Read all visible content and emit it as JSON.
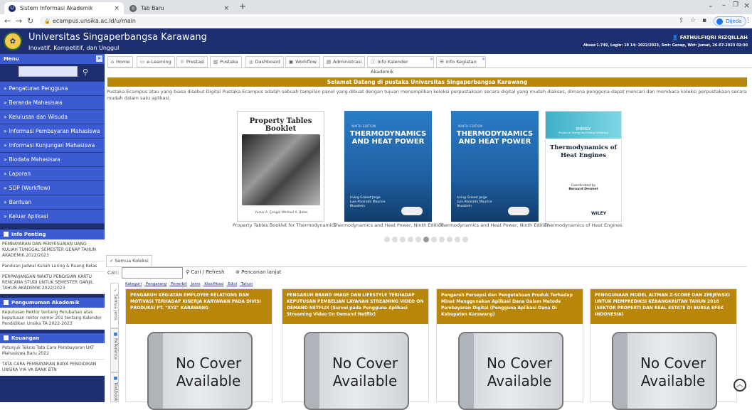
{
  "browser": {
    "tabs": [
      {
        "title": "Sistem Informasi Akademik",
        "active": true
      },
      {
        "title": "Tab Baru",
        "active": false
      }
    ],
    "new_tab": "+",
    "url": "ecampus.unsika.ac.id/u/main",
    "profile_label": "Dijeda"
  },
  "header": {
    "university": "Universitas Singaperbangsa Karawang",
    "tagline": "Inovatif, Kompetitif, dan Unggul",
    "user": "FATHULFIQRI RIZQILLAH",
    "access": "Akses:1.749, Login: 19 14: 2022/2023, Smt: Genap, Wkt: Jumat, 26-07-2023 02:30"
  },
  "sidebar": {
    "title": "Menu",
    "items": [
      "Pengaturan Pengguna",
      "Beranda Mahasiswa",
      "Kelulusan dan Wisuda",
      "Informasi Pembayaran Mahasiswa",
      "Informasi Kunjungan Mahasiswa",
      "Biodata Mahasiswa",
      "Laporan",
      "SOP (Workflow)",
      "Bantuan",
      "Keluar Aplikasi"
    ],
    "boxes": [
      {
        "title": "Info Penting",
        "items": [
          "PEMBAYARAN DAN PENYESUAIAN UANG KULIAH TUNGGAL SEMESTER GENAP TAHUN AKADEMIK 2022/2023",
          "Panduan Jadwal Kuliah Luring & Ruang Kelas",
          "PERPANJANGAN WAKTU PENGISIAN KARTU RENCANA STUDI UNTUK SEMESTER GANJIL TAHUN AKADEMIK 2022/2023"
        ]
      },
      {
        "title": "Pengumuman Akademik",
        "items": [
          "Keputusan Rektor tentang Perubahan atas keputusan rektor nomor 201 tentang Kalender Pendidikan Unsika TA 2022-2023"
        ]
      },
      {
        "title": "Keuangan",
        "items": [
          "Petunjuk Teknis Tata Cara Pembayaran UKT Mahasiswa Baru 2022",
          "TATA CARA PEMBAYARAN BIAYA PENDIDIKAN UNSIKA VIA VA BANK BTN"
        ]
      }
    ]
  },
  "tabs": [
    {
      "label": "Home",
      "icon": "home-icon"
    },
    {
      "label": "e-Learning",
      "icon": "monitor-icon"
    },
    {
      "label": "Prestasi",
      "icon": "trophy-icon"
    },
    {
      "label": "Pustaka",
      "icon": "library-icon"
    },
    {
      "label": "Dashboard",
      "icon": "dashboard-icon"
    },
    {
      "label": "Workflow",
      "icon": "workflow-icon"
    },
    {
      "label": "Administrasi",
      "icon": "admin-icon"
    },
    {
      "label": "Info Kalender Akademik",
      "icon": "info-icon"
    },
    {
      "label": "Info Kegiatan",
      "icon": "list-icon"
    }
  ],
  "main": {
    "welcome": "Selamat Datang di pustaka Universitas Singaperbangsa Karawang",
    "description": "Pustaka Ecampus atau yang biasa disebut Digital Pustaka Ecampus adalah sebuah tampilan panel yang dibuat dengan tujuan menampilkan koleksi perpustakaan secara digital yang mudah diakses, dimana pengguna dapat mencari dan membaca koleksi perpustakaan secara mudah dalam satu aplikasi.",
    "books": [
      {
        "caption": "Property Tables Booklet for Thermodynamics",
        "cover_title": "Property Tables Booklet",
        "cover_sub": "to accompany",
        "authors": "Yunus A. Çengel  Michael A. Boles"
      },
      {
        "caption": "Thermodynamics and Heat Power, Ninth Edition",
        "edition": "NINTH EDITION",
        "cover_title": "THERMODYNAMICS AND HEAT POWER",
        "authors": "Irving Granet  Jorge Luis Alvarado  Maurice Bluestein"
      },
      {
        "caption": "Thermodynamics and Heat Power, Ninth Edition",
        "edition": "NINTH EDITION",
        "cover_title": "THERMODYNAMICS AND HEAT POWER",
        "authors": "Irving Granet  Jorge Luis Alvarado  Maurice Bluestein"
      },
      {
        "caption": "Thermodynamics of Heat Engines",
        "series": "ENERGY",
        "subseries": "Physics of Energy and Energy Efficiency",
        "cover_title": "Thermodynamics of Heat Engines",
        "coordinated": "Coordinated by",
        "coordinator": "Bernard Desmet",
        "publisher": "WILEY"
      }
    ],
    "carousel_dots": 11,
    "carousel_active": 5
  },
  "collection": {
    "tab": "Semua Koleksi",
    "search_label": "Cari:",
    "search_value": "",
    "search_button": "Cari / Refresh",
    "advanced": "Pencarian lanjut",
    "filters": [
      "Kategori",
      "Pengarang",
      "Penerbit",
      "Jenis",
      "Klasifikasi",
      "Edisi",
      "Tahun"
    ],
    "vertical_tabs": [
      "Semua Jenis",
      "Reference",
      "Textbook"
    ],
    "cards": [
      "PENGARUH KEGIATAN EMPLOYEE RELATIONS DAN MOTIVASI TERHADAP KINERJA KARYAWAN PADA DIVISI PRODUKSI PT. \"XYZ\" KARAWANG",
      "PENGARUH BRAND IMAGE DAN LIFESTYLE TERHADAP KEPUTUSAN PEMBELIAN LAYANAN STREAMING VIDEO ON DEMAND NETFLIX (Survei pada Pengguna Aplikasi Streaming Video On Demand Netflix)",
      "Pengaruh Persepsi dan Pengetahuan Produk Terhadap Minat Menggunakan Aplikasi Dana Dalam Metode Pembayaran Digital (Pengguna Aplikasi Dana Di Kabupaten Karawang)",
      "PENGGUNAAN MODEL ALTMAN Z-SCORE DAN ZMIJEWSKI UNTUK MEMPREDIKSI KEBANGKRUTAN TAHUN 2018 (SEKTOR PROPERTI DAN REAL ESTATE DI BURSA EFEK INDONESIA)"
    ],
    "no_cover": "No Cover Available"
  }
}
